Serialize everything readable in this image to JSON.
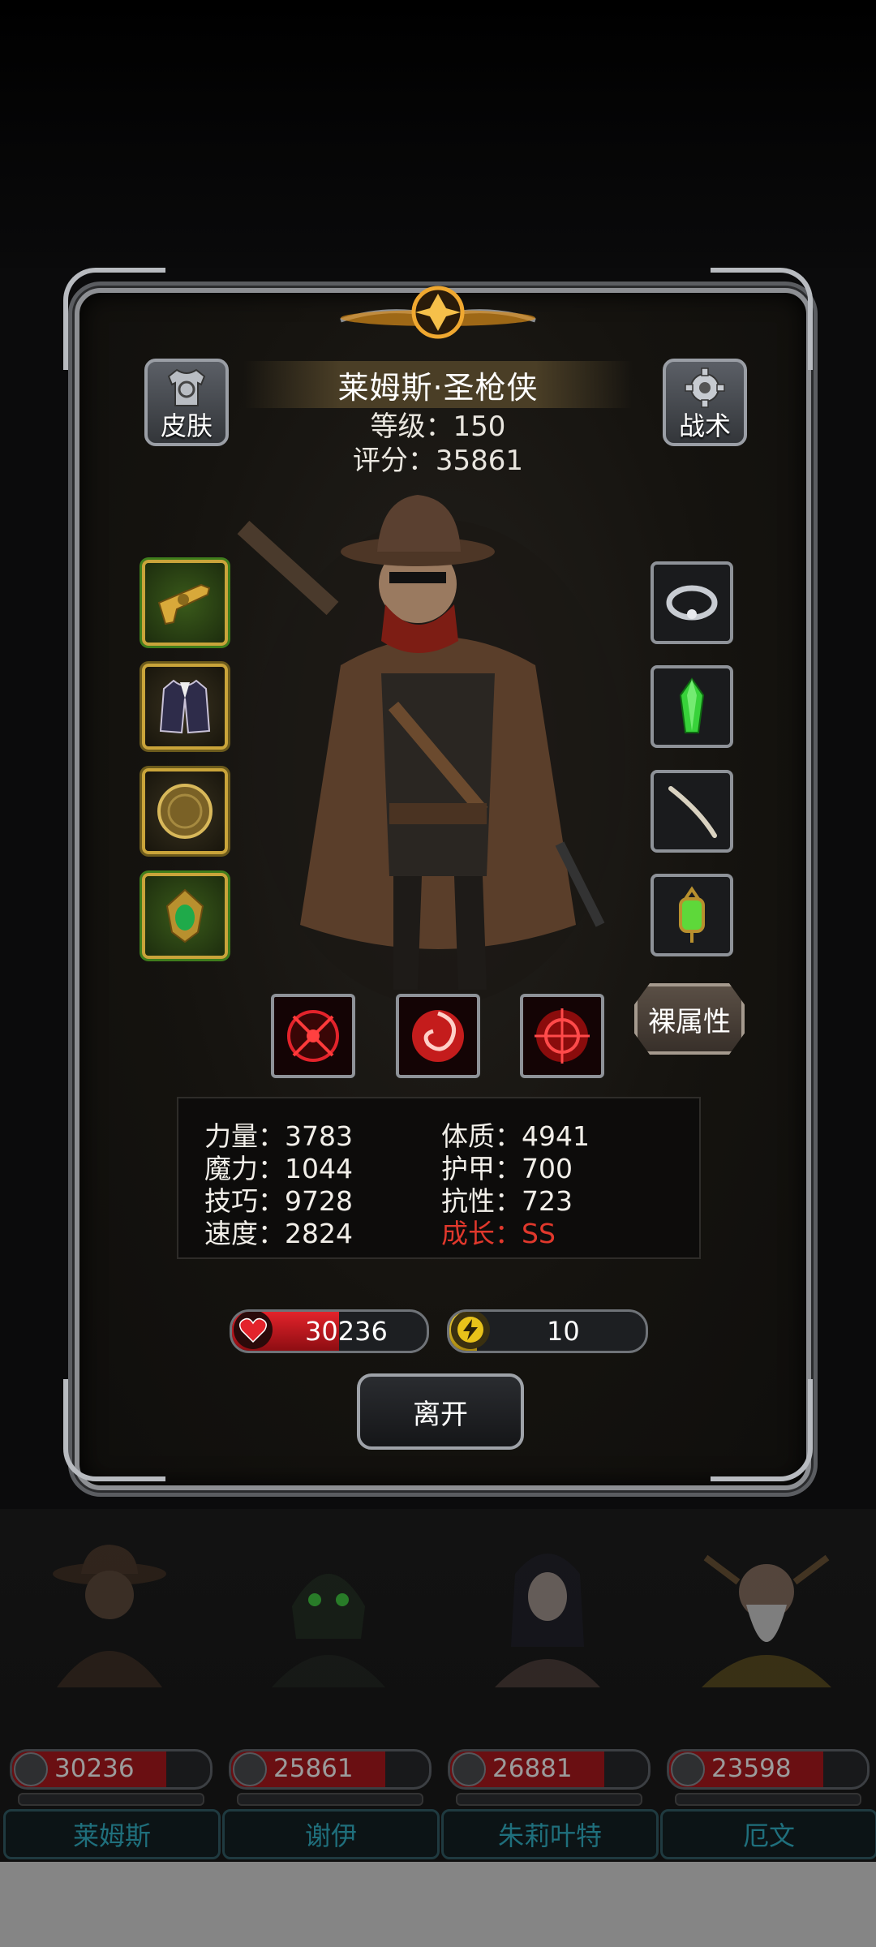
{
  "hero": {
    "name": "莱姆斯·圣枪侠",
    "level": "等级：150",
    "score": "评分：35861"
  },
  "buttons": {
    "skin": "皮肤",
    "tactics": "战术",
    "base_attributes": "裸属性",
    "leave": "离开"
  },
  "equipment_left": [
    {
      "icon": "golden-revolver-icon",
      "frame": "green"
    },
    {
      "icon": "coat-armor-icon",
      "frame": "gold"
    },
    {
      "icon": "round-shield-icon",
      "frame": "gold"
    },
    {
      "icon": "emerald-amulet-icon",
      "frame": "green"
    }
  ],
  "equipment_right": [
    {
      "icon": "silver-ring-icon"
    },
    {
      "icon": "green-crystal-icon"
    },
    {
      "icon": "bone-wand-icon"
    },
    {
      "icon": "green-lantern-icon"
    }
  ],
  "skills": [
    {
      "icon": "crosshair-skill-icon"
    },
    {
      "icon": "red-swirl-skill-icon"
    },
    {
      "icon": "red-target-skill-icon"
    }
  ],
  "stats": {
    "strength": "力量：3783",
    "constitution": "体质：4941",
    "magic": "魔力：1044",
    "armor": "护甲：700",
    "skill": "技巧：9728",
    "resistance": "抗性：723",
    "speed": "速度：2824",
    "growth": "成长：SS"
  },
  "vitals": {
    "hp": "30236",
    "hp_fill": 0.55,
    "energy": "10",
    "energy_fill": 0.14
  },
  "roster": [
    {
      "name": "莱姆斯",
      "power": "30236",
      "fill": 0.78
    },
    {
      "name": "谢伊",
      "power": "25861",
      "fill": 0.78
    },
    {
      "name": "朱莉叶特",
      "power": "26881",
      "fill": 0.78
    },
    {
      "name": "厄文",
      "power": "23598",
      "fill": 0.78
    }
  ],
  "colors": {
    "accent_red": "#e0382c",
    "hp_red": "#e3232b",
    "energy_yellow": "#f2d23a",
    "frame_gold": "#c9a43a"
  }
}
